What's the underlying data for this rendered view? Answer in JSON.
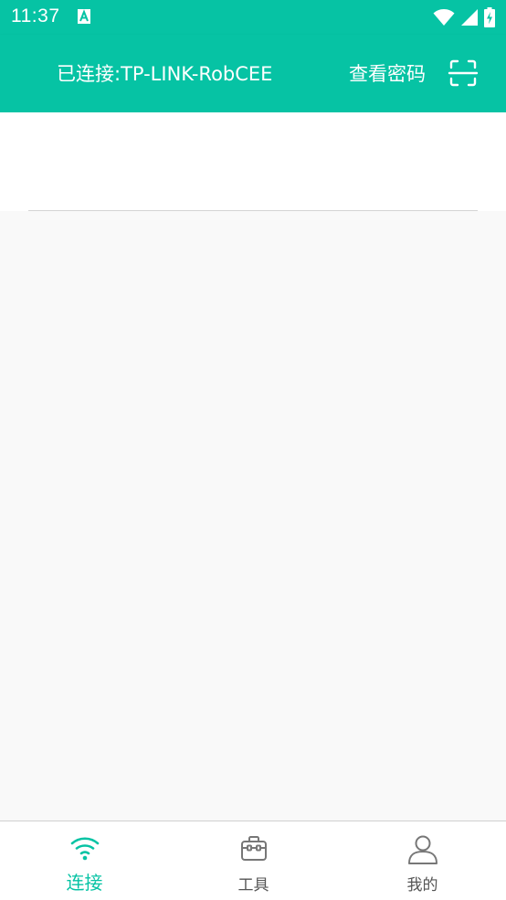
{
  "status_bar": {
    "time": "11:37",
    "icons": [
      "app-notification-icon",
      "wifi-icon",
      "cell-signal-icon",
      "battery-charging-icon"
    ]
  },
  "app_bar": {
    "title": "已连接:TP-LINK-RobCEE",
    "view_password_label": "查看密码",
    "scan_icon": "scan-icon"
  },
  "bottom_nav": {
    "items": [
      {
        "label": "连接",
        "icon": "wifi-icon",
        "active": true
      },
      {
        "label": "工具",
        "icon": "toolbox-icon",
        "active": false
      },
      {
        "label": "我的",
        "icon": "person-icon",
        "active": false
      }
    ]
  },
  "colors": {
    "primary": "#06c3a4",
    "background": "#f9f9f9",
    "inactive_text": "#555555",
    "inactive_icon": "#777777"
  }
}
